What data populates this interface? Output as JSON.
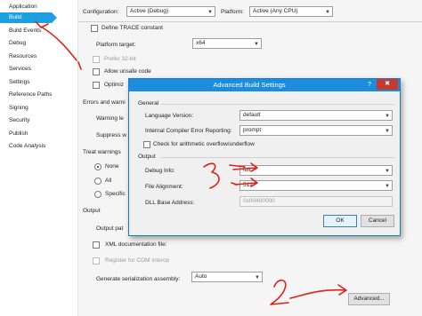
{
  "nav": {
    "items": [
      "Application",
      "Build",
      "Build Events",
      "Debug",
      "Resources",
      "Services",
      "Settings",
      "Reference Paths",
      "Signing",
      "Security",
      "Publish",
      "Code Analysis"
    ],
    "selected": "Build"
  },
  "config": {
    "configuration_label": "Configuration:",
    "configuration_value": "Active (Debug)",
    "platform_label": "Platform:",
    "platform_value": "Active (Any CPU)"
  },
  "general": {
    "define_trace": "Define TRACE constant",
    "platform_target_label": "Platform target:",
    "platform_target_value": "x64",
    "prefer32": "Prefer 32-bit",
    "allow_unsafe": "Allow unsafe code",
    "optimize": "Optimiz"
  },
  "errors": {
    "heading": "Errors and warni",
    "warning_level": "Warning le",
    "suppress": "Suppress w"
  },
  "treat_warnings": {
    "heading": "Treat warnings",
    "none": "None",
    "all": "All",
    "specific": "Specific"
  },
  "output": {
    "heading": "Output",
    "output_path": "Output pat",
    "xml_doc": "XML documentation file:",
    "register_com": "Register for COM interop",
    "serialization_label": "Generate serialization assembly:",
    "serialization_value": "Auto",
    "advanced_button": "Advanced..."
  },
  "dialog": {
    "title": "Advanced Build Settings",
    "help_glyph": "?",
    "close_glyph": "✖",
    "general_heading": "General",
    "language_label": "Language Version:",
    "language_value": "default",
    "error_report_label": "Internal Compiler Error Reporting:",
    "error_report_value": "prompt",
    "overflow_label": "Check for arithmetic overflow/underflow",
    "output_heading": "Output",
    "debug_info_label": "Debug Info:",
    "debug_info_value": "full",
    "file_alignment_label": "File Alignment:",
    "file_alignment_value": "512",
    "dll_base_label": "DLL Base Address:",
    "dll_base_value": "0x00400000",
    "ok": "OK",
    "cancel": "Cancel"
  },
  "annotations": {
    "step1": "1.",
    "step2": "2.",
    "step3": "3.",
    "color": "#e0201a"
  }
}
